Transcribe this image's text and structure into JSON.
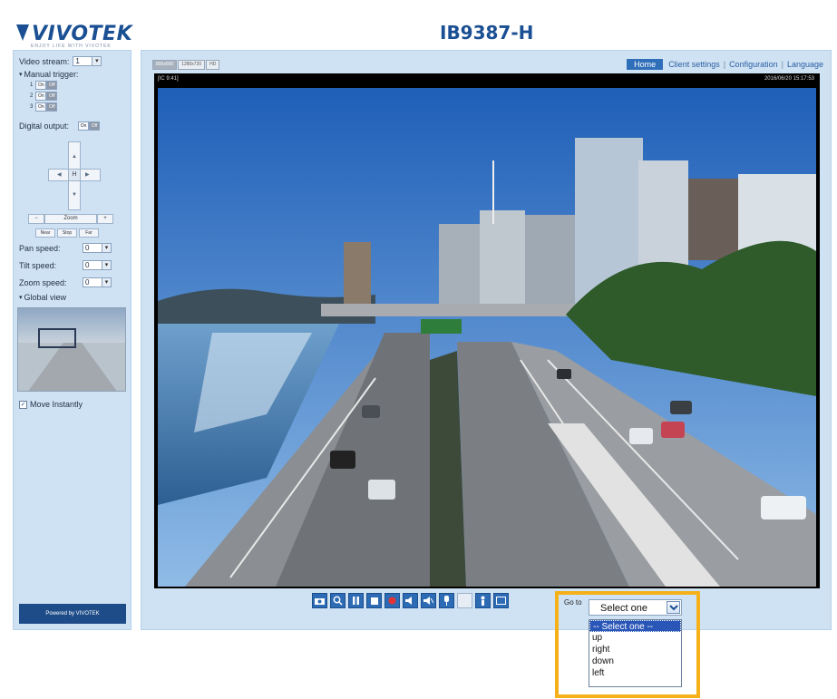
{
  "header": {
    "logo_text": "VIVOTEK",
    "logo_tagline": "ENJOY LIFE WITH VIVOTEK",
    "model": "IB9387-H"
  },
  "sidebar": {
    "video_stream_label": "Video stream:",
    "video_stream_value": "1",
    "manual_trigger_label": "Manual trigger:",
    "triggers": [
      {
        "label": "1",
        "on": "On",
        "off": "Off"
      },
      {
        "label": "2",
        "on": "On",
        "off": "Off"
      },
      {
        "label": "3",
        "on": "On",
        "off": "Off"
      }
    ],
    "digital_output_label": "Digital output:",
    "digital_output_on": "On",
    "digital_output_off": "Off",
    "ptz_home": "H",
    "zoom_minus": "−",
    "zoom_label": "Zoom",
    "zoom_plus": "+",
    "focus_buttons": [
      "Near",
      "Stop",
      "Far"
    ],
    "pan_speed_label": "Pan speed:",
    "pan_speed_value": "0",
    "tilt_speed_label": "Tilt speed:",
    "tilt_speed_value": "0",
    "zoom_speed_label": "Zoom speed:",
    "zoom_speed_value": "0",
    "global_view_label": "Global view",
    "move_instantly_label": "Move Instantly",
    "move_instantly_checked": true,
    "powered_by": "Powered by VIVOTEK"
  },
  "main": {
    "resolution_tabs": [
      "800x600",
      "1280x720",
      "HD"
    ],
    "nav": {
      "home": "Home",
      "client_settings": "Client settings",
      "configuration": "Configuration",
      "language": "Language"
    },
    "video": {
      "overlay_left": "[IC 9:41]",
      "overlay_right": "2016/06/20 15:17:53"
    },
    "controls": [
      "snapshot-icon",
      "digital-zoom-icon",
      "pause-icon",
      "stop-icon",
      "record-icon",
      "volume-icon",
      "mute-icon",
      "talk-icon",
      "mic-volume-icon",
      "ptz-control-icon",
      "fullscreen-icon"
    ],
    "goto_label": "Go to",
    "preset_select": {
      "value": "Select one",
      "options": [
        "-- Select one --",
        "up",
        "right",
        "down",
        "left"
      ],
      "selected_index": 0
    }
  },
  "colors": {
    "brand_blue": "#1a4f93",
    "panel_bg": "#cfe2f3",
    "highlight": "#f5b01a",
    "selection": "#2a56b8"
  }
}
